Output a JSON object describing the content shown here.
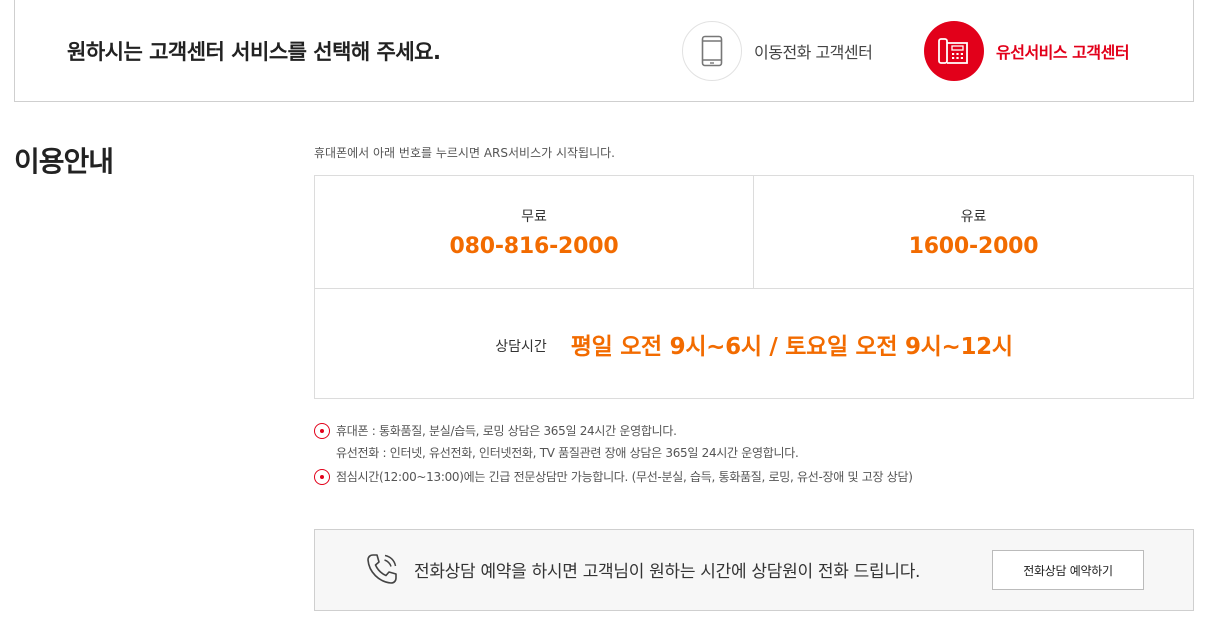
{
  "header": {
    "title": "원하시는 고객센터 서비스를 선택해 주세요.",
    "options": [
      {
        "label": "이동전화 고객센터",
        "icon": "mobile-phone-icon",
        "active": false
      },
      {
        "label": "유선서비스 고객센터",
        "icon": "landline-phone-icon",
        "active": true
      }
    ]
  },
  "guide": {
    "title": "이용안내",
    "intro": "휴대폰에서 아래 번호를 누르시면 ARS서비스가 시작됩니다.",
    "free": {
      "label": "무료",
      "number": "080-816-2000"
    },
    "paid": {
      "label": "유료",
      "number": "1600-2000"
    },
    "hours": {
      "label": "상담시간",
      "value": "평일 오전 9시~6시 / 토요일 오전 9시~12시"
    },
    "notes": [
      {
        "line1": "휴대폰 : 통화품질, 분실/습득, 로밍 상담은 365일 24시간 운영합니다.",
        "line2": "유선전화 : 인터넷, 유선전화, 인터넷전화, TV 품질관련 장애 상담은 365일 24시간 운영합니다."
      },
      {
        "line1": "점심시간(12:00~13:00)에는 긴급 전문상담만 가능합니다. (무선-분실, 습득, 통화품질, 로밍, 유선-장애 및 고장 상담)"
      }
    ]
  },
  "reservation": {
    "text": "전화상담 예약을 하시면 고객님이 원하는 시간에 상담원이 전화 드립니다.",
    "button_label": "전화상담 예약하기"
  },
  "colors": {
    "accent_red": "#e2001a",
    "number_orange": "#f26b00"
  }
}
